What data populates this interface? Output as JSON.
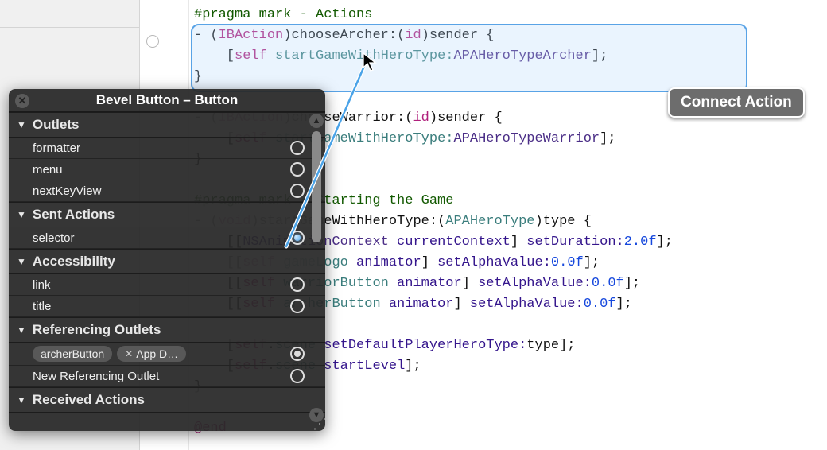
{
  "pragma1": "#pragma mark - Actions",
  "line2": {
    "ib": "IBAction",
    "name": "chooseArcher:",
    "id": "id",
    "sender": "sender {"
  },
  "line3": {
    "self": "self",
    "call": "startGameWithHeroType:",
    "arg": "APAHeroTypeArcher"
  },
  "brace1": "}",
  "line5": {
    "ib": "IBAction",
    "name": "chooseWarrior:",
    "id": "id",
    "sender": "sender {"
  },
  "line6": {
    "self": "self",
    "call": "startGameWithHeroType:",
    "arg": "APAHeroTypeWarrior",
    "prefix": "    [",
    "mid": " ",
    "closeParen": "];"
  },
  "brace2": "}",
  "pragma2": "#pragma mark - Starting the Game",
  "line9": {
    "ret": "void",
    "name": "startGameWithHeroType:",
    "type": "APAHeroType",
    "param": "type {"
  },
  "line10": {
    "a": "[[",
    "cls": "NSAnimationContext",
    "m1": " currentContext",
    "m2": "] ",
    "m3": "setDuration:",
    "num": "2.0f",
    "end": "];"
  },
  "line11": {
    "a": "[[",
    "self": "self",
    "prop": " gameLogo",
    "anim": " animator",
    "m": "] ",
    "set": "setAlphaValue:",
    "num": "0.0f",
    "end": "];"
  },
  "line12": {
    "a": "[[",
    "self": "self",
    "prop": " warriorButton",
    "anim": " animator",
    "m": "] ",
    "set": "setAlphaValue:",
    "num": "0.0f",
    "end": "];"
  },
  "line13": {
    "a": "[[",
    "self": "self",
    "prop": " archerButton",
    "anim": " animator",
    "m": "] ",
    "set": "setAlphaValue:",
    "num": "0.0f",
    "end": "];"
  },
  "line15": {
    "a": "[",
    "self": "self",
    "dot": ".",
    "prop": "scene",
    "m": " setDefaultPlayerHeroType:",
    "arg": "type",
    "end": "];"
  },
  "line16": {
    "a": "[",
    "self": "self",
    "dot": ".",
    "prop": "scene",
    "m": " startLevel",
    "end": "];"
  },
  "brace3": "}",
  "end": "@end",
  "hud": {
    "title": "Bevel Button – Button",
    "sections": {
      "outlets": "Outlets",
      "outlets_items": [
        "formatter",
        "menu",
        "nextKeyView"
      ],
      "sent": "Sent Actions",
      "sent_items": [
        "selector"
      ],
      "access": "Accessibility",
      "access_items": [
        "link",
        "title"
      ],
      "ref": "Referencing Outlets",
      "ref_item1": "archerButton",
      "ref_item1_target": "App D…",
      "ref_item2": "New Referencing Outlet",
      "recv": "Received Actions"
    }
  },
  "tooltip": "Connect Action"
}
